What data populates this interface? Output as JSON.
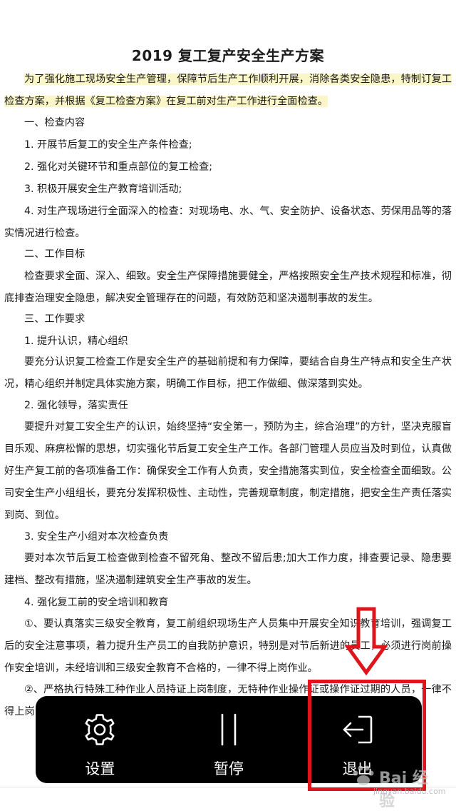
{
  "document": {
    "title": "2019 复工复产安全生产方案",
    "paragraphs": [
      "为了强化施工现场安全生产管理，保障节后生产工作顺利开展，消除各类安全隐患，特制订复工检查方案，并根据《复工检查方案》在复工前对生产工作进行全面检查。",
      "一、检查内容",
      "1. 开展节后复工的安全生产条件检查;",
      "2. 强化对关键环节和重点部位的复工检查;",
      "3. 积极开展安全生产教育培训活动;",
      "4. 对生产现场进行全面深入的检查：对现场电、水、气、安全防护、设备状态、劳保用品等的落实情况进行检查。",
      "二、工作目标",
      "检查要求全面、深入、细致。安全生产保障措施要健全，严格按照安全生产技术规程和标准，彻底排查治理安全隐患，解决安全管理存在的问题，有效防范和坚决遏制事故的发生。",
      "三、工作要求",
      "1. 提升认识，精心组织",
      "要充分认识复工检查工作是安全生产的基础前提和有力保障，要结合自身生产特点和安全生产状况，精心组织并制定具体实施方案，明确工作目标，把工作做细、做深落到实处。",
      "2. 强化领导，落实责任",
      "要提升对复工安全生产的认识，始终坚持“安全第一，预防为主，综合治理”的方针，坚决克服盲目乐观、麻痹松懈的思想，切实强化节后复工安全生产工作。各部门管理人员应当及时到位，认真做好生产复工前的各项准备工作：确保安全工作有人负责，安全措施落实到位，安全检查全面细致。公司安全生产小组组长，要充分发挥积极性、主动性，完善规章制度，制定措施，把安全生产责任落实到岗、到位。",
      "3. 安全生产小组对本次检查负责",
      "要对本次节后复工检查做到检查不留死角、整改不留后患;加大工作力度，排查要记录、隐患要建档、整改有措施，坚决遏制建筑安全生产事故的发生。",
      "4. 强化复工前的安全培训和教育",
      "①、要认真落实三级安全教育，复工前组织现场生产人员集中开展安全知识教育培训，强调复工后的安全注意事项，着力提升生产员工的自我防护意识，特别是对节后新进的员工，必须进行岗前操作安全培训，未经培训和三级安全教育不合格的，一律不得上岗作业。",
      "②、严格执行特殊工种作业人员持证上岗制度，无特种作业操作证或操作证过期的人员，一律不得上岗"
    ]
  },
  "toolbar": {
    "settings_label": "设置",
    "pause_label": "暂停",
    "exit_label": "退出"
  },
  "icons": {
    "settings": "gear-icon",
    "pause": "pause-icon",
    "exit": "exit-icon"
  },
  "colors": {
    "highlight": "#fbf6c8",
    "toolbar_bg": "#000000",
    "annotation": "#e0141b"
  },
  "watermark": {
    "main": "Bai 经验",
    "sub": "jingyan.baidu.com"
  }
}
